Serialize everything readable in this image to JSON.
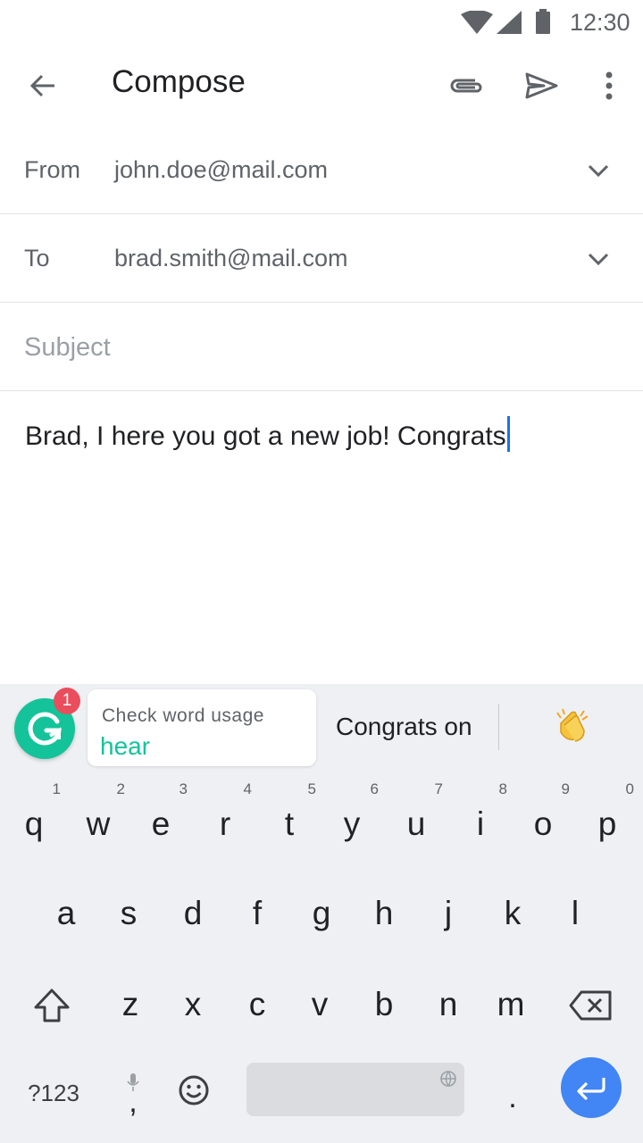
{
  "status_bar": {
    "time": "12:30"
  },
  "app_bar": {
    "title": "Compose"
  },
  "from": {
    "label": "From",
    "value": "john.doe@mail.com"
  },
  "to": {
    "label": "To",
    "value": "brad.smith@mail.com"
  },
  "subject": {
    "placeholder": "Subject"
  },
  "body": {
    "text": "Brad, I here you got a new job! Congrats"
  },
  "grammarly": {
    "badge_count": "1",
    "card_title": "Check word usage",
    "card_word": "hear",
    "accent_color": "#15c39a"
  },
  "suggestions": {
    "word": "Congrats on",
    "emoji": "clapping-hands"
  },
  "keyboard": {
    "row1": [
      {
        "ch": "q",
        "num": "1"
      },
      {
        "ch": "w",
        "num": "2"
      },
      {
        "ch": "e",
        "num": "3"
      },
      {
        "ch": "r",
        "num": "4"
      },
      {
        "ch": "t",
        "num": "5"
      },
      {
        "ch": "y",
        "num": "6"
      },
      {
        "ch": "u",
        "num": "7"
      },
      {
        "ch": "i",
        "num": "8"
      },
      {
        "ch": "o",
        "num": "9"
      },
      {
        "ch": "p",
        "num": "0"
      }
    ],
    "row2": [
      "a",
      "s",
      "d",
      "f",
      "g",
      "h",
      "j",
      "k",
      "l"
    ],
    "row3": [
      "z",
      "x",
      "c",
      "v",
      "b",
      "n",
      "m"
    ],
    "symbols_key": "?123",
    "comma_key": ",",
    "period_key": "."
  }
}
